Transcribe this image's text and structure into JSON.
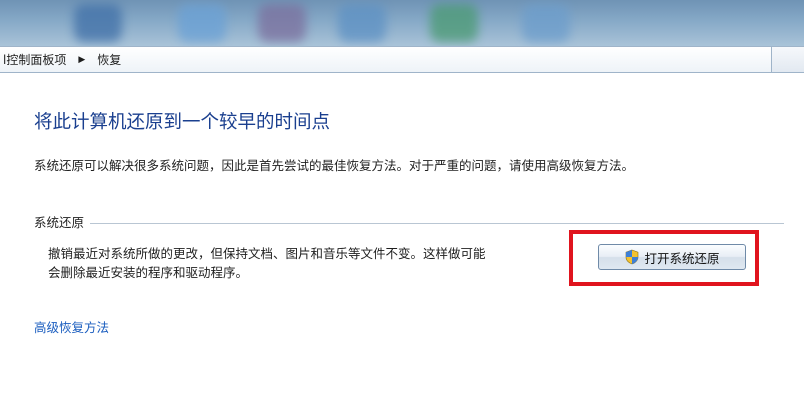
{
  "breadcrumb": {
    "items": [
      "l控制面板项",
      "恢复"
    ],
    "separator": "▶"
  },
  "main": {
    "title": "将此计算机还原到一个较早的时间点",
    "description": "系统还原可以解决很多系统问题，因此是首先尝试的最佳恢复方法。对于严重的问题，请使用高级恢复方法。"
  },
  "system_restore": {
    "section_label": "系统还原",
    "description_line1": "撤销最近对系统所做的更改，但保持文档、图片和音乐等文件不变。这样做可能",
    "description_line2": "会删除最近安装的程序和驱动程序。",
    "button_label": "打开系统还原",
    "button_icon": "uac-shield-icon",
    "highlight_color": "#e0141e"
  },
  "advanced_link": {
    "label": "高级恢复方法"
  },
  "colors": {
    "title_blue": "#1a3f8f",
    "link_blue": "#1a5dbf",
    "text": "#1e1e1e"
  }
}
